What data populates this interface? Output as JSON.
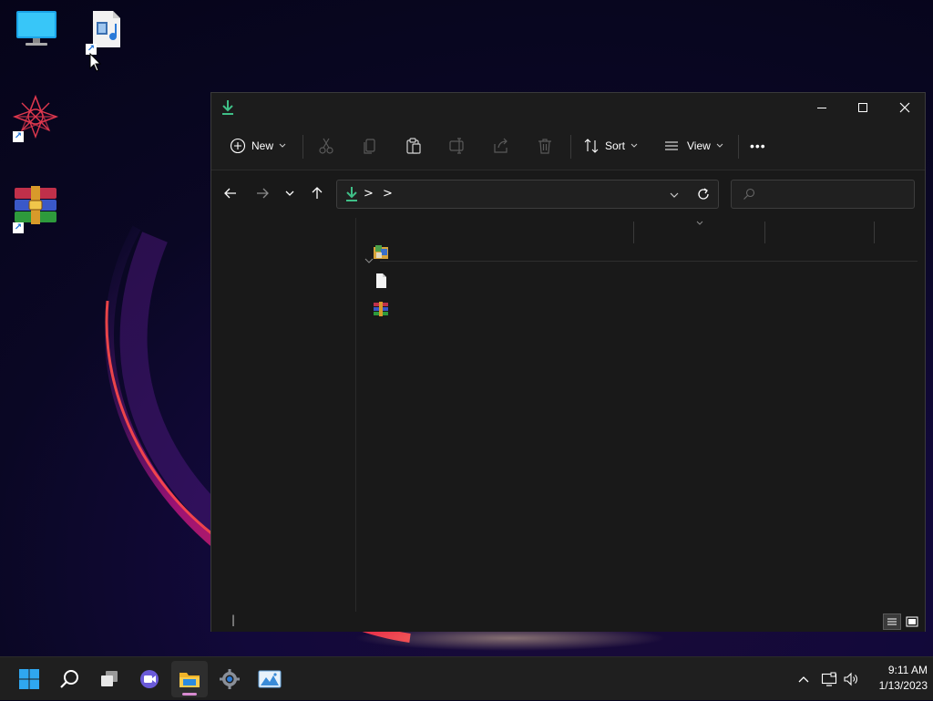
{
  "desktop": {
    "icons": [
      {
        "name": "This PC",
        "icon": "monitor-icon",
        "shortcut": false
      },
      {
        "name": "Media file",
        "icon": "media-file-icon",
        "shortcut": true
      },
      {
        "name": "Fractal app",
        "icon": "fractal-app-icon",
        "shortcut": true
      },
      {
        "name": "WinRAR",
        "icon": "winrar-icon",
        "shortcut": true
      }
    ]
  },
  "explorer": {
    "title_icon": "downloads-icon",
    "toolbar": {
      "new_label": "New",
      "sort_label": "Sort",
      "view_label": "View",
      "more_label": "•••",
      "actions": [
        "cut-icon",
        "copy-icon",
        "paste-icon",
        "rename-icon",
        "share-icon",
        "delete-icon"
      ]
    },
    "address": {
      "location_icon": "downloads-icon",
      "separators": [
        ">",
        ">"
      ]
    },
    "search": {
      "placeholder": ""
    },
    "files": [
      {
        "icon": "installer-package-icon"
      },
      {
        "icon": "blank-document-icon"
      },
      {
        "icon": "winrar-archive-icon"
      }
    ],
    "status": {
      "cursor": "|"
    }
  },
  "taskbar": {
    "apps": [
      "start-icon",
      "search-icon",
      "task-view-icon",
      "chat-icon",
      "file-explorer-icon",
      "settings-icon",
      "photos-icon"
    ],
    "active_app": "file-explorer-icon",
    "tray": [
      "chevron-up-icon",
      "network-icon",
      "volume-icon"
    ],
    "clock": {
      "time": "9:11 AM",
      "date": "1/13/2023"
    }
  },
  "colors": {
    "accent_green": "#3fbf87",
    "accent_pink": "#d88bd1",
    "window_bg": "#191919"
  }
}
